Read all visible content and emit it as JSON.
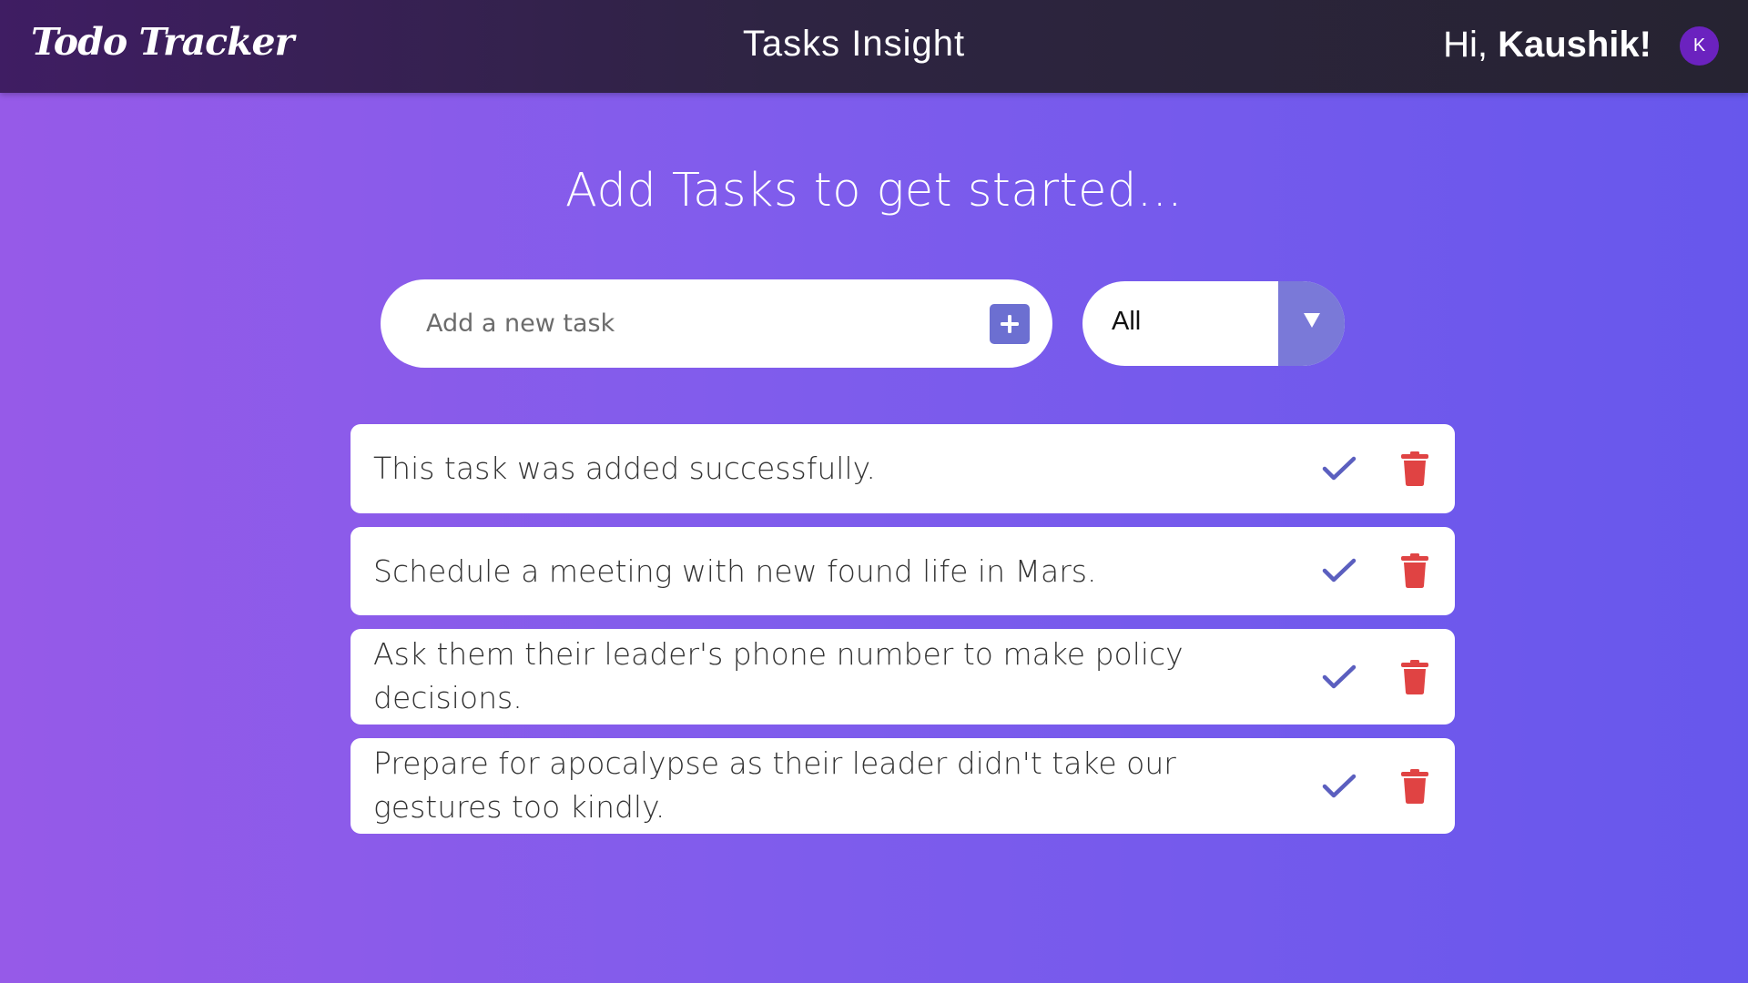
{
  "header": {
    "brand": "Todo Tracker",
    "title": "Tasks Insight",
    "greeting_prefix": "Hi, ",
    "user_name": "Kaushik!",
    "avatar_initial": "K"
  },
  "main": {
    "intro": "Add Tasks to get started...",
    "input_placeholder": "Add a new task",
    "input_value": "",
    "filter_selected": "All"
  },
  "tasks": [
    {
      "text": "This task was added successfully."
    },
    {
      "text": "Schedule a meeting with new found life in Mars."
    },
    {
      "text": "Ask them their leader's phone number to make policy decisions."
    },
    {
      "text": "Prepare for apocalypse as their leader didn't take our gestures too kindly."
    }
  ],
  "icons": {
    "add": "plus-icon",
    "filter_toggle": "triangle-down-icon",
    "complete": "check-icon",
    "delete": "trash-icon"
  },
  "colors": {
    "background_start": "#965ae8",
    "background_end": "#6757ec",
    "header_bg": "#2e2442",
    "accent": "#6c6fd1",
    "avatar_bg": "#6b22bf",
    "check": "#5b5fbf",
    "delete": "#e04343"
  }
}
